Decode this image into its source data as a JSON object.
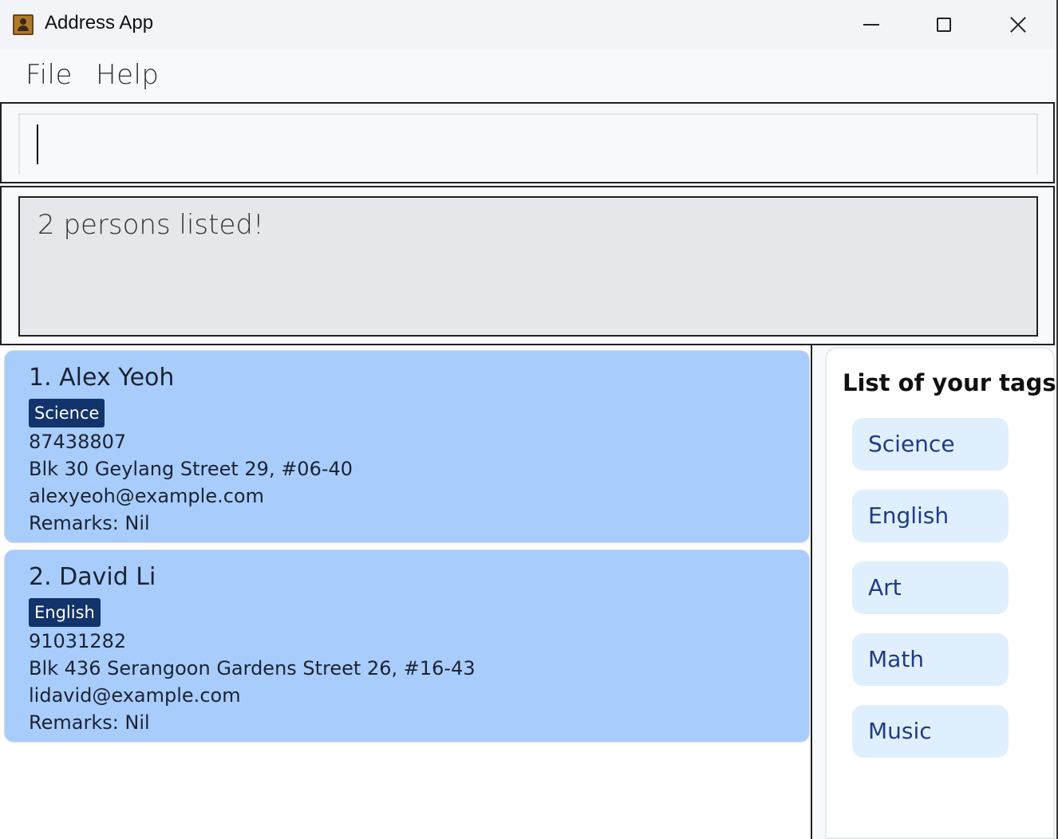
{
  "window": {
    "title": "Address App",
    "icon": "address-book-icon"
  },
  "menu": {
    "file_label": "File",
    "help_label": "Help"
  },
  "command": {
    "value": "",
    "placeholder": ""
  },
  "result": {
    "message": "2 persons listed!"
  },
  "persons": [
    {
      "index_name": "1. Alex Yeoh",
      "tag": "Science",
      "phone": "87438807",
      "address": "Blk 30 Geylang Street 29, #06-40",
      "email": "alexyeoh@example.com",
      "remarks": "Remarks: Nil"
    },
    {
      "index_name": "2. David Li",
      "tag": "English",
      "phone": "91031282",
      "address": "Blk 436 Serangoon Gardens Street 26, #16-43",
      "email": "lidavid@example.com",
      "remarks": "Remarks: Nil"
    }
  ],
  "tags_panel": {
    "title": "List of your tags",
    "tags": [
      "Science",
      "English",
      "Art",
      "Math",
      "Music"
    ]
  },
  "colors": {
    "card_background": "#a8cdfc",
    "tag_badge": "#12336b",
    "tag_chip": "#e0effd",
    "tag_chip_text": "#213b86",
    "result_background": "#e5e7eb"
  }
}
